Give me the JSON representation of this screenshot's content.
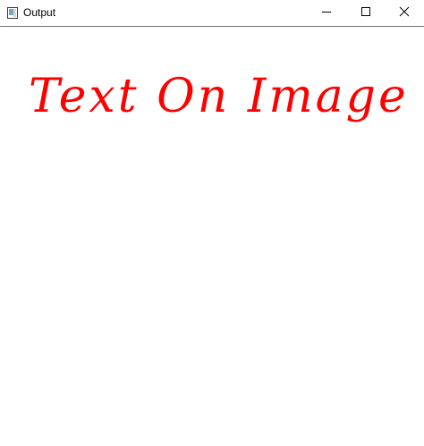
{
  "window": {
    "title": "Output",
    "controls": {
      "minimize_icon": "minimize-icon",
      "maximize_icon": "maximize-icon",
      "close_icon": "close-icon"
    }
  },
  "image": {
    "overlay_text": "Text On Image",
    "text_color": "#ff0000",
    "background_color": "#ffffff"
  }
}
